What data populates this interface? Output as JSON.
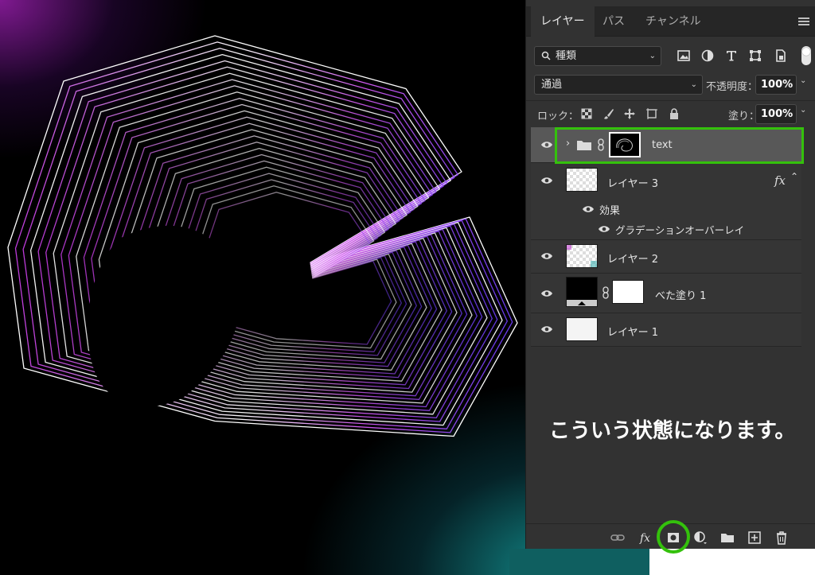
{
  "panel": {
    "tabs": [
      {
        "label": "レイヤー",
        "active": true
      },
      {
        "label": "パス",
        "active": false
      },
      {
        "label": "チャンネル",
        "active": false
      }
    ],
    "filter": {
      "kind_label": "種類",
      "icons": [
        "image-filter-icon",
        "adjustment-filter-icon",
        "text-filter-icon",
        "shape-filter-icon",
        "smart-object-filter-icon"
      ]
    },
    "blend_mode": "通過",
    "opacity_label": "不透明度：",
    "opacity_value": "100%",
    "lock_label": "ロック：",
    "fill_label": "塗り：",
    "fill_value": "100%",
    "layers": [
      {
        "name": "text",
        "type": "group",
        "selected": true,
        "has_mask": true
      },
      {
        "name": "レイヤー 3",
        "type": "pixel",
        "fx": "fx",
        "effects_label": "効果",
        "effect_item": "グラデーションオーバーレイ"
      },
      {
        "name": "レイヤー 2",
        "type": "pixel"
      },
      {
        "name": "べた塗り 1",
        "type": "fill"
      },
      {
        "name": "レイヤー 1",
        "type": "pixel"
      }
    ],
    "footer_icons": [
      "link-layers-icon",
      "fx-icon",
      "add-mask-icon",
      "new-adjustment-icon",
      "new-group-icon",
      "new-layer-icon",
      "trash-icon"
    ]
  },
  "annotation": "こういう状態になります。",
  "colors": {
    "highlight": "#34c10c",
    "panel_bg": "#323232",
    "selected_layer": "#585858"
  }
}
